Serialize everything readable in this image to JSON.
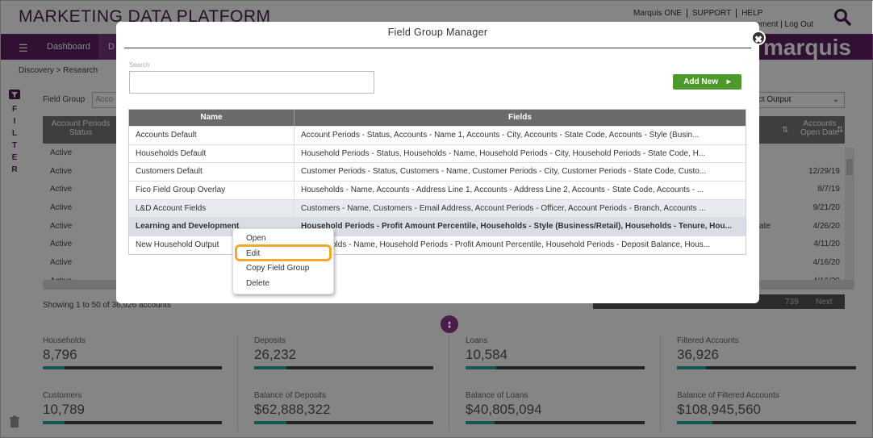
{
  "header": {
    "app_title": "MARKETING DATA PLATFORM",
    "top_links": [
      "Marquis ONE",
      "SUPPORT",
      "HELP"
    ],
    "top_links2": "opment | Log Out",
    "logo": "marquis"
  },
  "nav": {
    "dashboard": "Dashboard",
    "tab2": "D"
  },
  "breadcrumb": "Discovery  >  Research",
  "filter_side": [
    "F",
    "I",
    "L",
    "T",
    "E",
    "R"
  ],
  "field_group": {
    "label": "Field Group",
    "value": "Acco"
  },
  "output_select": "lect Output",
  "background_table": {
    "left_header": "Account Periods Status",
    "left_values": [
      "Active",
      "Active",
      "Active",
      "Active",
      "Active",
      "Active",
      "Active",
      "Active",
      "Active"
    ],
    "right_header": "Accounts Open Date",
    "right_values": [
      "",
      "12/29/19",
      "8/7/19",
      "9/21/20",
      "4/26/20",
      "4/11/20",
      "4/16/20",
      "4/16/20"
    ],
    "right_state": "ate",
    "showing": "Showing 1 to 50 of 36,926 accounts",
    "pager_739": "739",
    "pager_next": "Next"
  },
  "stats": [
    {
      "label": "Households",
      "value": "8,796",
      "fill": 0.12
    },
    {
      "label": "Deposits",
      "value": "26,232",
      "fill": 0.18
    },
    {
      "label": "Loans",
      "value": "10,584",
      "fill": 0.17
    },
    {
      "label": "Filtered Accounts",
      "value": "36,926",
      "fill": 0.16
    },
    {
      "label": "Customers",
      "value": "10,789",
      "fill": 0.12
    },
    {
      "label": "Balance of Deposits",
      "value": "$62,888,322",
      "fill": 0.18
    },
    {
      "label": "Balance of Loans",
      "value": "$40,805,094",
      "fill": 0.16
    },
    {
      "label": "Balance of Filtered Accounts",
      "value": "$108,945,560",
      "fill": 0.2
    }
  ],
  "modal": {
    "title": "Field Group Manager",
    "close": "✖",
    "search_label": "Search",
    "search_value": "",
    "add_new": "Add New",
    "columns": [
      "Name",
      "Fields"
    ],
    "rows": [
      {
        "name": "Accounts Default",
        "fields": "Account Periods - Status, Accounts - Name 1, Accounts - City, Accounts - State Code, Accounts - Style (Busin..."
      },
      {
        "name": "Households Default",
        "fields": "Household Periods - Status, Households - Name, Household Periods - City, Household Periods - State Code, H..."
      },
      {
        "name": "Customers Default",
        "fields": "Customer Periods - Status, Customers - Name, Customer Periods - City, Customer Periods - State Code, Custo..."
      },
      {
        "name": "Fico Field Group Overlay",
        "fields": "Households - Name, Accounts - Address Line 1, Accounts - Address Line 2, Accounts - State Code, Accounts - ..."
      },
      {
        "name": "L&D Account Fields",
        "fields": "Customers - Name, Customers - Email Address, Account Periods - Officer, Account Periods - Branch, Accounts ..."
      },
      {
        "name": "Learning and Development",
        "fields": "Household Periods - Profit Amount Percentile, Households - Style (Business/Retail), Households - Tenure, Hou..."
      },
      {
        "name": "New Household Output",
        "fields": "olds - Name, Household Periods - Profit Amount Percentile, Household Periods - Deposit Balance, Hous..."
      }
    ]
  },
  "context_menu": {
    "items": [
      "Open",
      "Edit",
      "Copy Field Group",
      "Delete"
    ],
    "highlighted": "Edit"
  }
}
